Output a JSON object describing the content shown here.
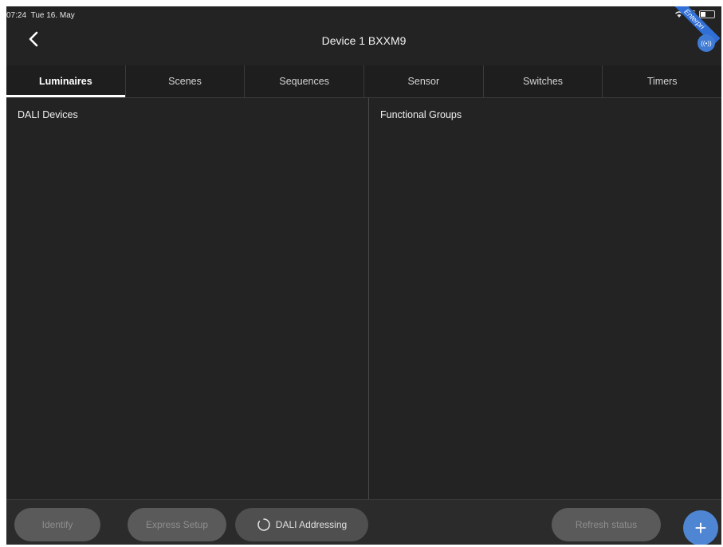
{
  "status_bar": {
    "time": "07:24",
    "date": "Tue 16. May",
    "battery": "36",
    "ribbon": "Enterpri"
  },
  "nav": {
    "title": "Device 1 BXXM9",
    "back_icon": "chevron-left-icon",
    "signal_icon": "broadcast-icon",
    "signal_label": "((•))"
  },
  "tabs": [
    {
      "label": "Luminaires",
      "active": true
    },
    {
      "label": "Scenes",
      "active": false
    },
    {
      "label": "Sequences",
      "active": false
    },
    {
      "label": "Sensor",
      "active": false
    },
    {
      "label": "Switches",
      "active": false
    },
    {
      "label": "Timers",
      "active": false
    }
  ],
  "panels": {
    "left_title": "DALI Devices",
    "right_title": "Functional Groups"
  },
  "bottom_bar": {
    "identify_label": "Identify",
    "express_setup_label": "Express Setup",
    "dali_addressing_label": "DALI Addressing",
    "refresh_status_label": "Refresh status",
    "add_label": "+"
  },
  "colors": {
    "background": "#232323",
    "accent": "#4f86d4",
    "disabled_button": "#5a5a5a"
  }
}
